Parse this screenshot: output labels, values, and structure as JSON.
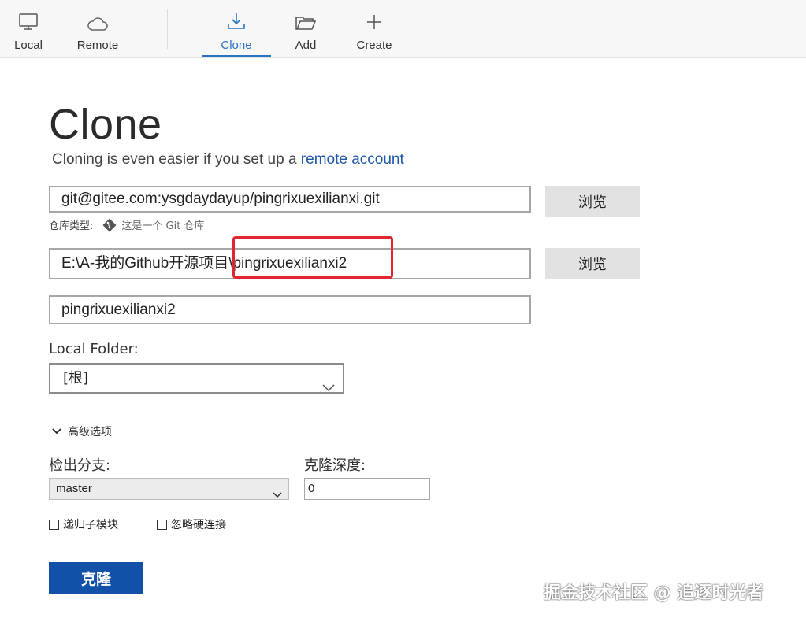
{
  "toolbar": {
    "items": [
      {
        "label": "Local",
        "icon": "monitor-icon"
      },
      {
        "label": "Remote",
        "icon": "cloud-icon"
      },
      {
        "label": "Clone",
        "icon": "download-icon",
        "active": true
      },
      {
        "label": "Add",
        "icon": "folder-open-icon"
      },
      {
        "label": "Create",
        "icon": "plus-icon"
      }
    ],
    "active_color": "#2a74c4"
  },
  "page": {
    "title": "Clone",
    "subtitle_prefix": "Cloning is even easier if you set up a ",
    "subtitle_link": "remote account"
  },
  "form": {
    "url_value": "git@gitee.com:ysgdaydayup/pingrixuexilianxi.git",
    "browse_label": "浏览",
    "repo_type_label": "仓库类型:",
    "repo_type_value": "这是一个 Git 仓库",
    "path_value": "E:\\A-我的Github开源项目\\pingrixuexilianxi2",
    "name_value": "pingrixuexilianxi2",
    "local_folder_label": "Local Folder:",
    "local_folder_value": "[根]",
    "advanced_label": "高级选项",
    "branch_label": "检出分支:",
    "branch_value": "master",
    "depth_label": "克隆深度:",
    "depth_value": "0",
    "recurse_label": "递归子模块",
    "ignore_hardlinks_label": "忽略硬连接",
    "clone_button": "克隆"
  },
  "colors": {
    "primary_button": "#1251a8",
    "link": "#1f58a8",
    "highlight_box": "#e0262e"
  },
  "watermark": "掘金技术社区 @ 追逐时光者"
}
